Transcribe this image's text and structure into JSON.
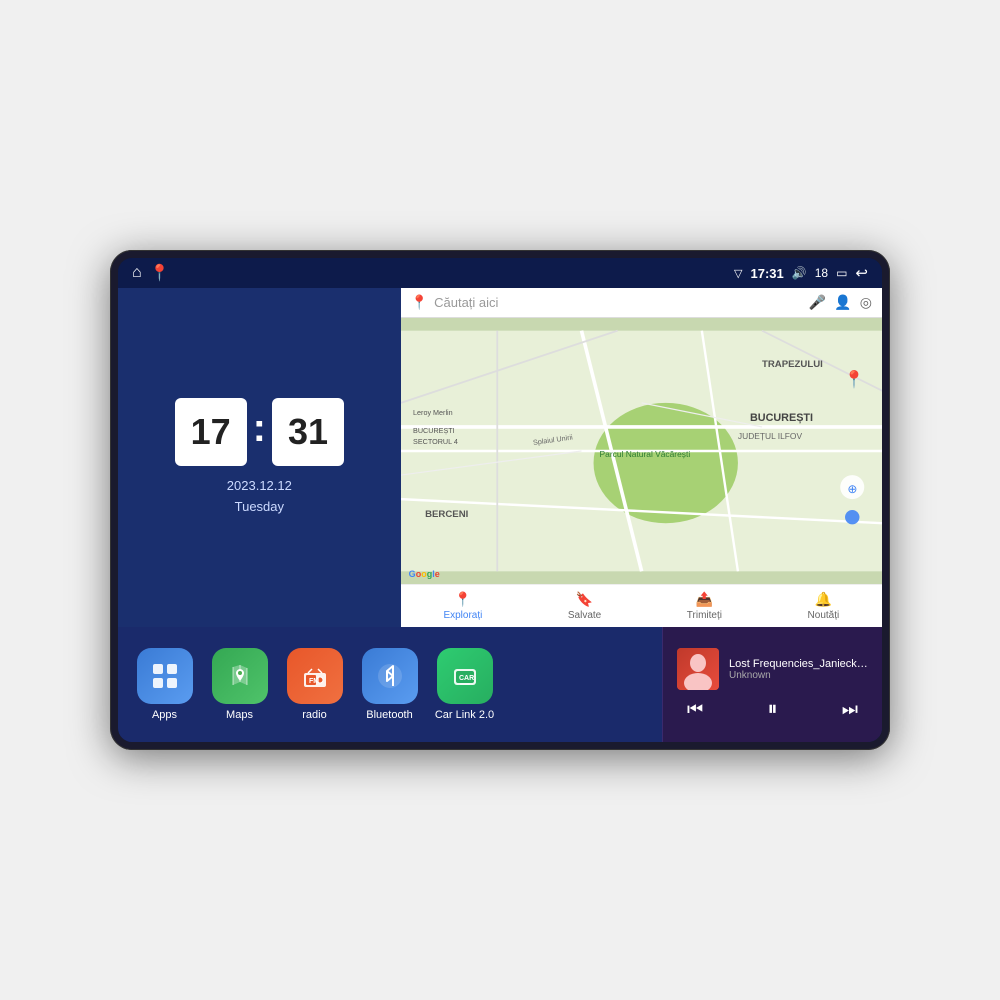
{
  "device": {
    "status_bar": {
      "left_icons": [
        "home",
        "maps-pin"
      ],
      "time": "17:31",
      "signal_icon": "▽",
      "volume_icon": "🔊",
      "battery": "18",
      "battery_icon": "▭",
      "back_icon": "↩"
    },
    "clock": {
      "hour": "17",
      "minute": "31",
      "date": "2023.12.12",
      "day": "Tuesday"
    },
    "map": {
      "search_placeholder": "Căutați aici",
      "nav_items": [
        {
          "label": "Explorați",
          "active": true
        },
        {
          "label": "Salvate",
          "active": false
        },
        {
          "label": "Trimiteți",
          "active": false
        },
        {
          "label": "Noutăți",
          "active": false
        }
      ],
      "labels": [
        "TRAPEZULUI",
        "BUCUREȘTI",
        "JUDEȚUL ILFOV",
        "BERCENI",
        "Parcul Natural Văcărești",
        "Leroy Merlin",
        "BUCUREȘTI SECTORUL 4"
      ]
    },
    "apps": [
      {
        "id": "apps",
        "label": "Apps",
        "icon": "⊞",
        "color_class": "icon-apps"
      },
      {
        "id": "maps",
        "label": "Maps",
        "icon": "📍",
        "color_class": "icon-maps"
      },
      {
        "id": "radio",
        "label": "radio",
        "icon": "📻",
        "color_class": "icon-radio"
      },
      {
        "id": "bluetooth",
        "label": "Bluetooth",
        "icon": "⚡",
        "color_class": "icon-bluetooth"
      },
      {
        "id": "carlink",
        "label": "Car Link 2.0",
        "icon": "🔗",
        "color_class": "icon-carlink"
      }
    ],
    "music": {
      "title": "Lost Frequencies_Janieck Devy-...",
      "artist": "Unknown",
      "thumbnail_emoji": "🎵"
    }
  }
}
